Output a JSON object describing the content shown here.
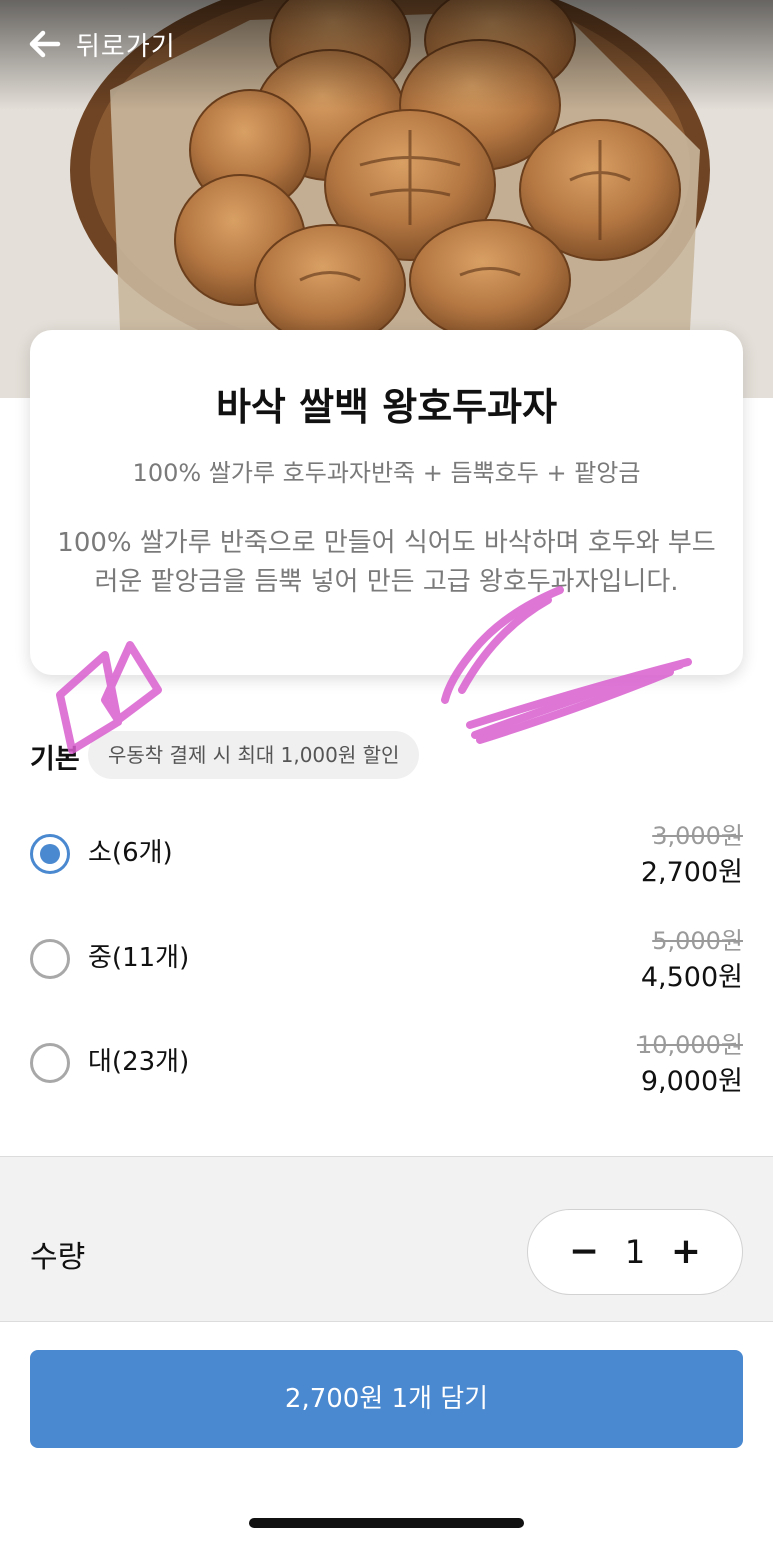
{
  "nav": {
    "back_label": "뒤로가기"
  },
  "product": {
    "title": "바삭 쌀백 왕호두과자",
    "subtitle": "100% 쌀가루 호두과자반죽 + 듬뿍호두 + 팥앙금",
    "description": "100% 쌀가루 반죽으로 만들어 식어도 바삭하며 호두와 부드러운 팥앙금을 듬뿍 넣어 만든 고급 왕호두과자입니다."
  },
  "options": {
    "section_label": "기본",
    "discount_note": "우동착 결제 시 최대 1,000원 할인",
    "items": [
      {
        "name": "소(6개)",
        "original_price": "3,000원",
        "price": "2,700원",
        "selected": true
      },
      {
        "name": "중(11개)",
        "original_price": "5,000원",
        "price": "4,500원",
        "selected": false
      },
      {
        "name": "대(23개)",
        "original_price": "10,000원",
        "price": "9,000원",
        "selected": false
      }
    ]
  },
  "quantity": {
    "label": "수량",
    "value": "1",
    "minus": "−",
    "plus": "+"
  },
  "cart_button": {
    "label": "2,700원 1개 담기"
  },
  "colors": {
    "accent": "#4a88cf",
    "scribble": "#d95fd0",
    "hero_photo": "#b57843"
  },
  "icons": {
    "back": "arrow-left-icon",
    "radio_on": "radio-checked-icon",
    "radio_off": "radio-unchecked-icon"
  }
}
